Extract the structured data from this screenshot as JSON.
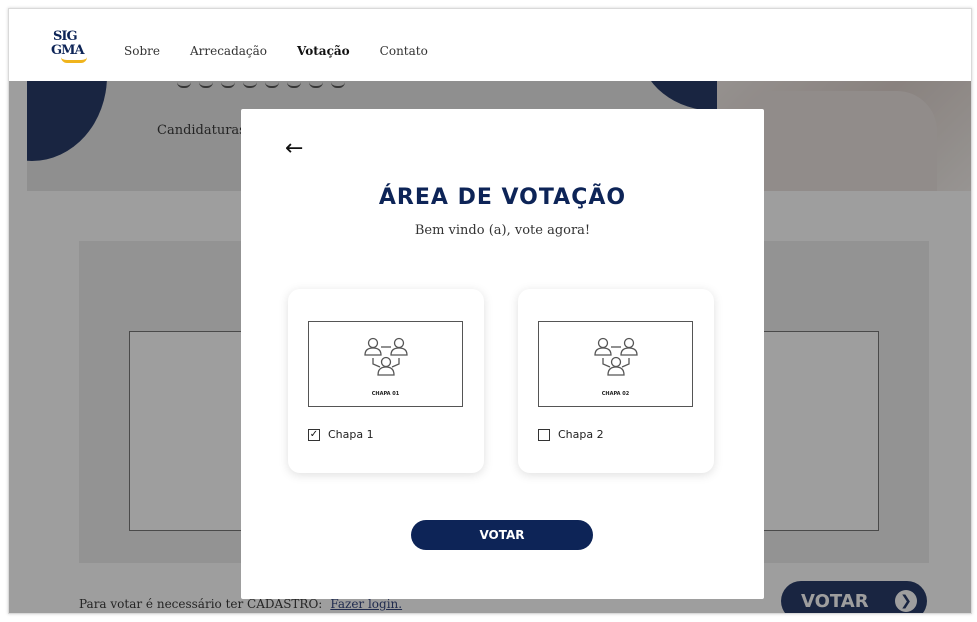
{
  "header": {
    "logo_line1": "SIG",
    "logo_line2": "GMA",
    "nav": [
      {
        "label": "Sobre",
        "active": false
      },
      {
        "label": "Arrecadação",
        "active": false
      },
      {
        "label": "Votação",
        "active": true
      },
      {
        "label": "Contato",
        "active": false
      }
    ]
  },
  "background": {
    "candidaturas_label": "Candidaturas",
    "footer_text": "Para votar é necessário ter CADASTRO:",
    "footer_link": "Fazer login.",
    "votar_button": "VOTAR",
    "arrow_glyph": "❯"
  },
  "modal": {
    "back_glyph": "←",
    "title": "ÁREA DE VOTAÇÃO",
    "subtitle": "Bem vindo (a), vote agora!",
    "chapas": [
      {
        "image_label": "CHAPA 01",
        "label": "Chapa 1",
        "checked": true
      },
      {
        "image_label": "CHAPA 02",
        "label": "Chapa 2",
        "checked": false
      }
    ],
    "vote_button": "VOTAR"
  },
  "colors": {
    "brand_navy": "#0d2457",
    "logo_accent": "#f0b41c"
  },
  "icons": {
    "back": "arrow-left-icon",
    "chapa": "group-people-icon",
    "check": "checkmark-icon"
  }
}
